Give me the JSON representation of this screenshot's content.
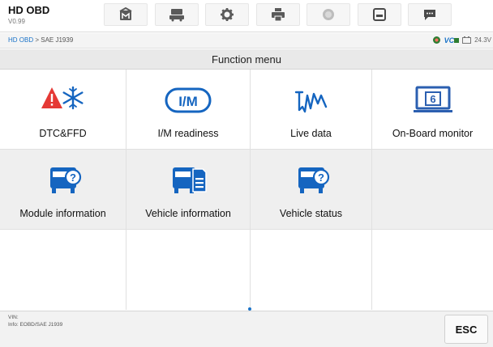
{
  "app": {
    "title": "HD OBD",
    "version": "V0.99"
  },
  "toolbar": {
    "buttons": [
      {
        "icon": "home-icon"
      },
      {
        "icon": "vehicle-swap-icon"
      },
      {
        "icon": "settings-gear-icon"
      },
      {
        "icon": "print-icon"
      },
      {
        "icon": "help-icon"
      },
      {
        "icon": "save-icon"
      },
      {
        "icon": "message-icon"
      }
    ]
  },
  "breadcrumb": {
    "link": "HD OBD",
    "separator": " > ",
    "current": "SAE J1939"
  },
  "status": {
    "vci_label": "VC",
    "voltage": "24.3V"
  },
  "menu": {
    "title": "Function menu",
    "items": [
      {
        "label": "DTC&FFD",
        "icon": "dtc-warning-snowflake-icon"
      },
      {
        "label": "I/M readiness",
        "icon": "im-readiness-icon"
      },
      {
        "label": "Live data",
        "icon": "live-data-waveform-icon"
      },
      {
        "label": "On-Board monitor",
        "icon": "onboard-monitor-icon"
      },
      {
        "label": "Module information",
        "icon": "truck-question-icon"
      },
      {
        "label": "Vehicle information",
        "icon": "truck-document-icon"
      },
      {
        "label": "Vehicle status",
        "icon": "truck-question-icon"
      }
    ]
  },
  "footer": {
    "vin": "VIN:",
    "info": "Info: EOBD/SAE J1939",
    "esc_label": "ESC"
  },
  "colors": {
    "accent": "#1a73c8",
    "icon_blue": "#1565c0",
    "warning_red": "#e53935",
    "monitor_blue": "#2b5fb0"
  }
}
